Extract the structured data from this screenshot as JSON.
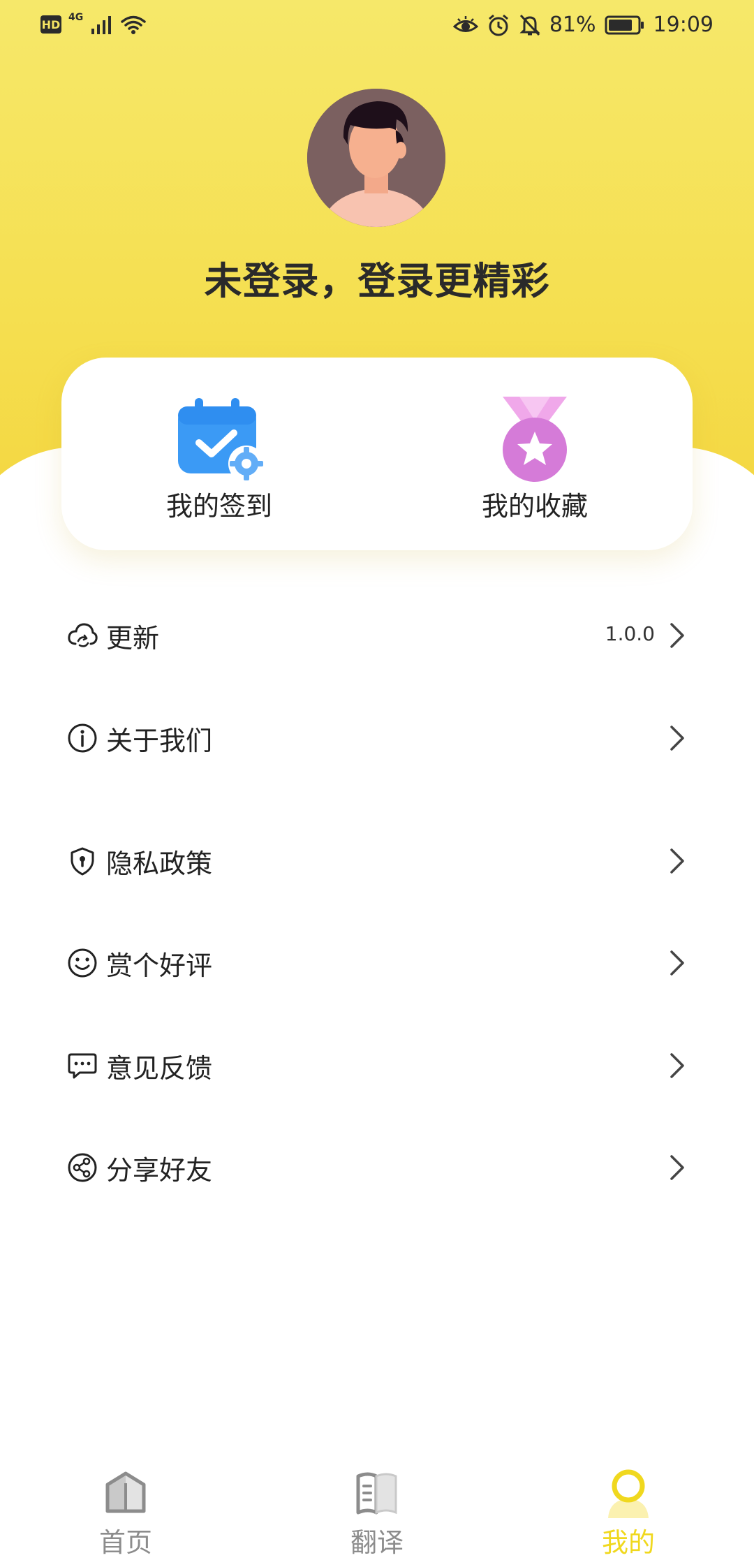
{
  "status_bar": {
    "hd_label": "HD",
    "network_label": "4G",
    "battery": "81%",
    "time": "19:09",
    "icons": [
      "signal-icon",
      "wifi-icon",
      "eye-icon",
      "alarm-icon",
      "mute-icon",
      "battery-icon"
    ]
  },
  "profile": {
    "avatar": "avatar-icon",
    "title": "未登录，登录更精彩"
  },
  "quick_actions": [
    {
      "label": "我的签到",
      "icon": "calendar-check-icon",
      "color": "#3b9af5"
    },
    {
      "label": "我的收藏",
      "icon": "medal-star-icon",
      "color": "#d57bd8"
    }
  ],
  "menu": [
    {
      "label": "更新",
      "icon": "cloud-refresh-icon",
      "value": "1.0.0"
    },
    {
      "label": "关于我们",
      "icon": "info-icon",
      "value": ""
    },
    {
      "label": "隐私政策",
      "icon": "shield-icon",
      "value": ""
    },
    {
      "label": "赏个好评",
      "icon": "smile-icon",
      "value": ""
    },
    {
      "label": "意见反馈",
      "icon": "message-icon",
      "value": ""
    },
    {
      "label": "分享好友",
      "icon": "share-icon",
      "value": ""
    }
  ],
  "bottom_nav": [
    {
      "label": "首页",
      "icon": "home-icon",
      "active": false
    },
    {
      "label": "翻译",
      "icon": "book-icon",
      "active": false
    },
    {
      "label": "我的",
      "icon": "profile-icon",
      "active": true
    }
  ],
  "colors": {
    "header_yellow": "#f5e15a",
    "accent_yellow": "#f0d81e",
    "nav_inactive": "#8c8c8c",
    "text": "#222222"
  }
}
